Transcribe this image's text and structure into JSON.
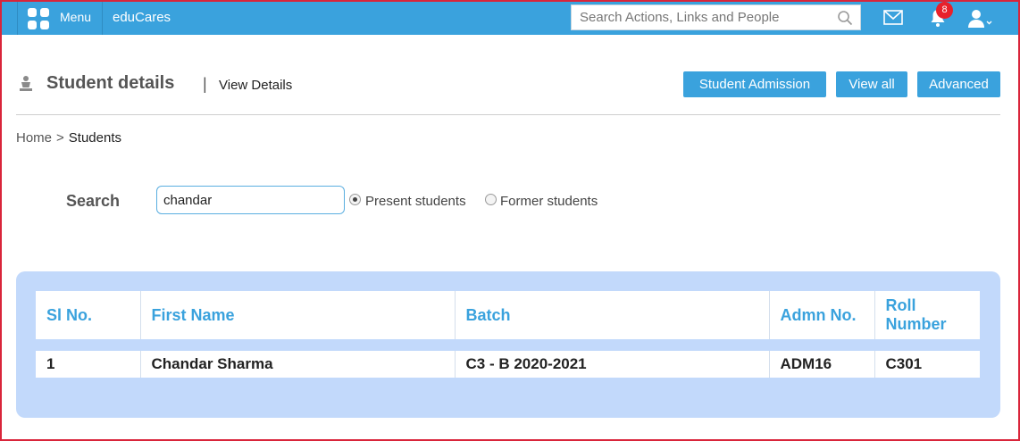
{
  "topbar": {
    "menu_label": "Menu",
    "brand": "eduCares",
    "search_placeholder": "Search Actions, Links and People",
    "notification_count": "8",
    "colors": {
      "bar": "#3aa2dd",
      "badge": "#e8212b"
    },
    "icons": [
      "grid-icon",
      "search-icon",
      "mail-icon",
      "bell-icon",
      "user-icon",
      "chevron-down-icon"
    ]
  },
  "header": {
    "title": "Student details",
    "separator": "|",
    "subtitle": "View Details",
    "buttons": {
      "admission": "Student Admission",
      "view_all": "View all",
      "advanced": "Advanced"
    }
  },
  "breadcrumb": {
    "home": "Home",
    "separator": ">",
    "current": "Students"
  },
  "search": {
    "label": "Search",
    "value": "chandar",
    "options": [
      {
        "label": "Present students",
        "checked": true
      },
      {
        "label": "Former students",
        "checked": false
      }
    ]
  },
  "table": {
    "headers": [
      "Sl No.",
      "First Name",
      "Batch",
      "Admn No.",
      "Roll Number"
    ],
    "rows": [
      [
        "1",
        "Chandar Sharma",
        "C3 - B 2020-2021",
        "ADM16",
        "C301"
      ]
    ]
  }
}
